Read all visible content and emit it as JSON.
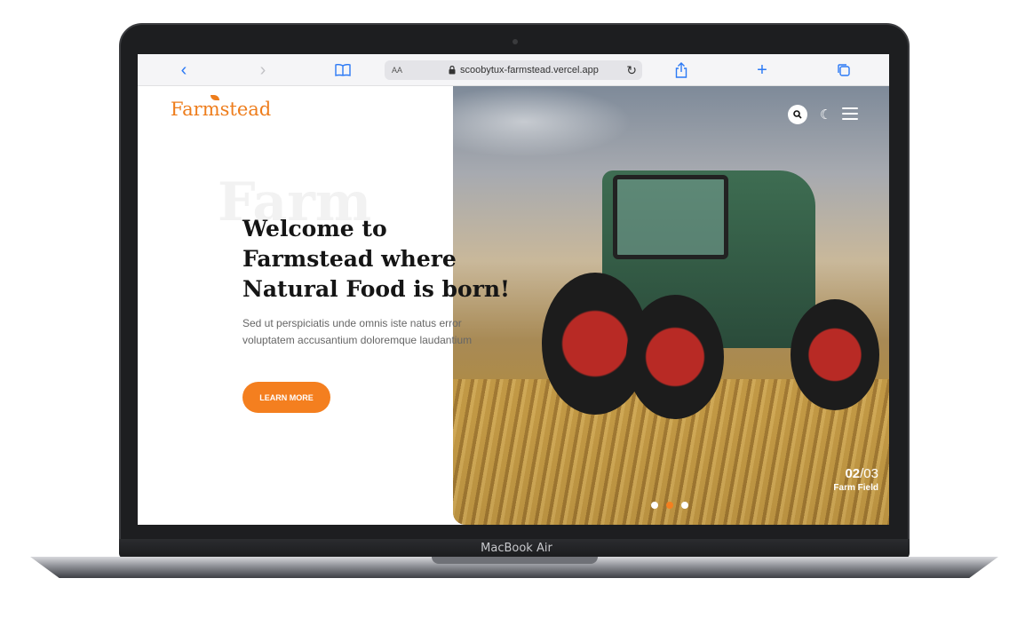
{
  "device": {
    "model_label": "MacBook Air"
  },
  "browser": {
    "address_text_size": "AA",
    "url": "scoobytux-farmstead.vercel.app",
    "icons": [
      "back-icon",
      "forward-icon",
      "bookmarks-icon",
      "lock-icon",
      "reload-icon",
      "share-icon",
      "new-tab-icon",
      "tabs-icon"
    ]
  },
  "site": {
    "logo": "Farmstead",
    "background_word": "Farm",
    "heading": "Welcome to Farmstead where Natural Food is born!",
    "description_line1": "Sed ut perspiciatis unde omnis iste natus error",
    "description_line2": "voluptatem accusantium doloremque laudantium",
    "cta_label": "LEARN MORE",
    "slider": {
      "current": "02",
      "total": "/03",
      "caption": "Farm Field",
      "active_index": 2,
      "count": 3
    },
    "colors": {
      "accent": "#f47f1f",
      "logo": "#ee7d1c"
    }
  }
}
